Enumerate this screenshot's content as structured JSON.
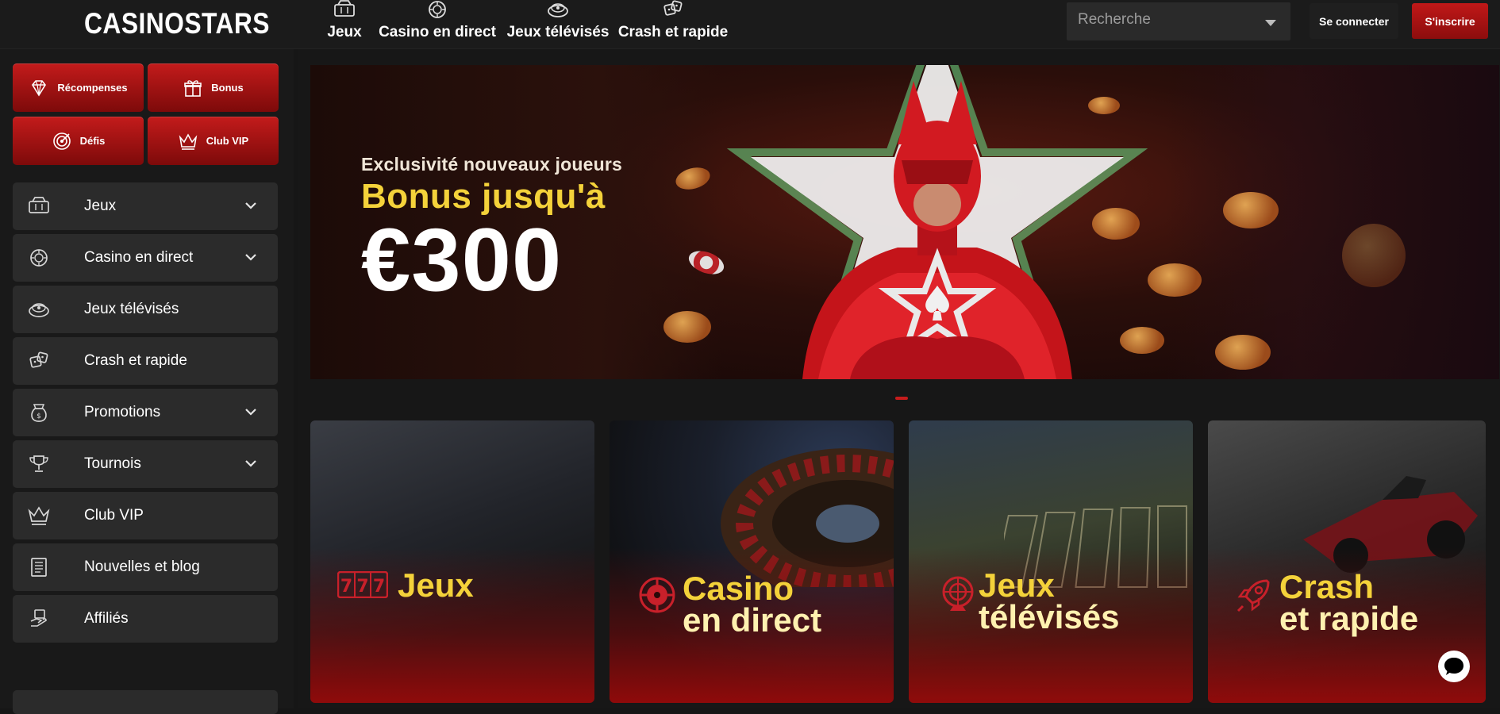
{
  "brand": {
    "name": "CASINOSTARS",
    "accent": "#c61c1c",
    "gold": "#f4d23a"
  },
  "topnav": [
    {
      "label": "Jeux",
      "icon": "slot-machine-icon"
    },
    {
      "label": "Casino en direct",
      "icon": "roulette-chip-icon"
    },
    {
      "label": "Jeux télévisés",
      "icon": "game-show-icon"
    },
    {
      "label": "Crash et rapide",
      "icon": "dice-icon"
    }
  ],
  "search": {
    "placeholder": "Recherche"
  },
  "auth": {
    "login": "Se connecter",
    "signup": "S'inscrire"
  },
  "quick": [
    {
      "label": "Récompenses",
      "icon": "diamond-icon"
    },
    {
      "label": "Bonus",
      "icon": "gift-icon"
    },
    {
      "label": "Défis",
      "icon": "target-icon"
    },
    {
      "label": "Club VIP",
      "icon": "crown-icon"
    }
  ],
  "sidebar": [
    {
      "label": "Jeux",
      "icon": "slot-machine-icon",
      "expandable": true
    },
    {
      "label": "Casino en direct",
      "icon": "roulette-chip-icon",
      "expandable": true
    },
    {
      "label": "Jeux télévisés",
      "icon": "game-show-icon",
      "expandable": false
    },
    {
      "label": "Crash et rapide",
      "icon": "dice-icon",
      "expandable": false
    },
    {
      "label": "Promotions",
      "icon": "money-bag-icon",
      "expandable": true
    },
    {
      "label": "Tournois",
      "icon": "trophy-icon",
      "expandable": true
    },
    {
      "label": "Club VIP",
      "icon": "crown-icon",
      "expandable": false
    },
    {
      "label": "Nouvelles et blog",
      "icon": "newspaper-icon",
      "expandable": false
    },
    {
      "label": "Affiliés",
      "icon": "affiliate-icon",
      "expandable": false
    }
  ],
  "hero": {
    "subtitle": "Exclusivité nouveaux joueurs",
    "title": "Bonus jusqu'à",
    "amount": "€300"
  },
  "categories": [
    {
      "line1": "Jeux",
      "line2": "",
      "icon": "777-slot-icon"
    },
    {
      "line1": "Casino",
      "line2": "en direct",
      "icon": "roulette-wheel-icon"
    },
    {
      "line1": "Jeux",
      "line2": "télévisés",
      "icon": "wheel-of-fortune-icon"
    },
    {
      "line1": "Crash",
      "line2": "et rapide",
      "icon": "rocket-icon"
    }
  ]
}
